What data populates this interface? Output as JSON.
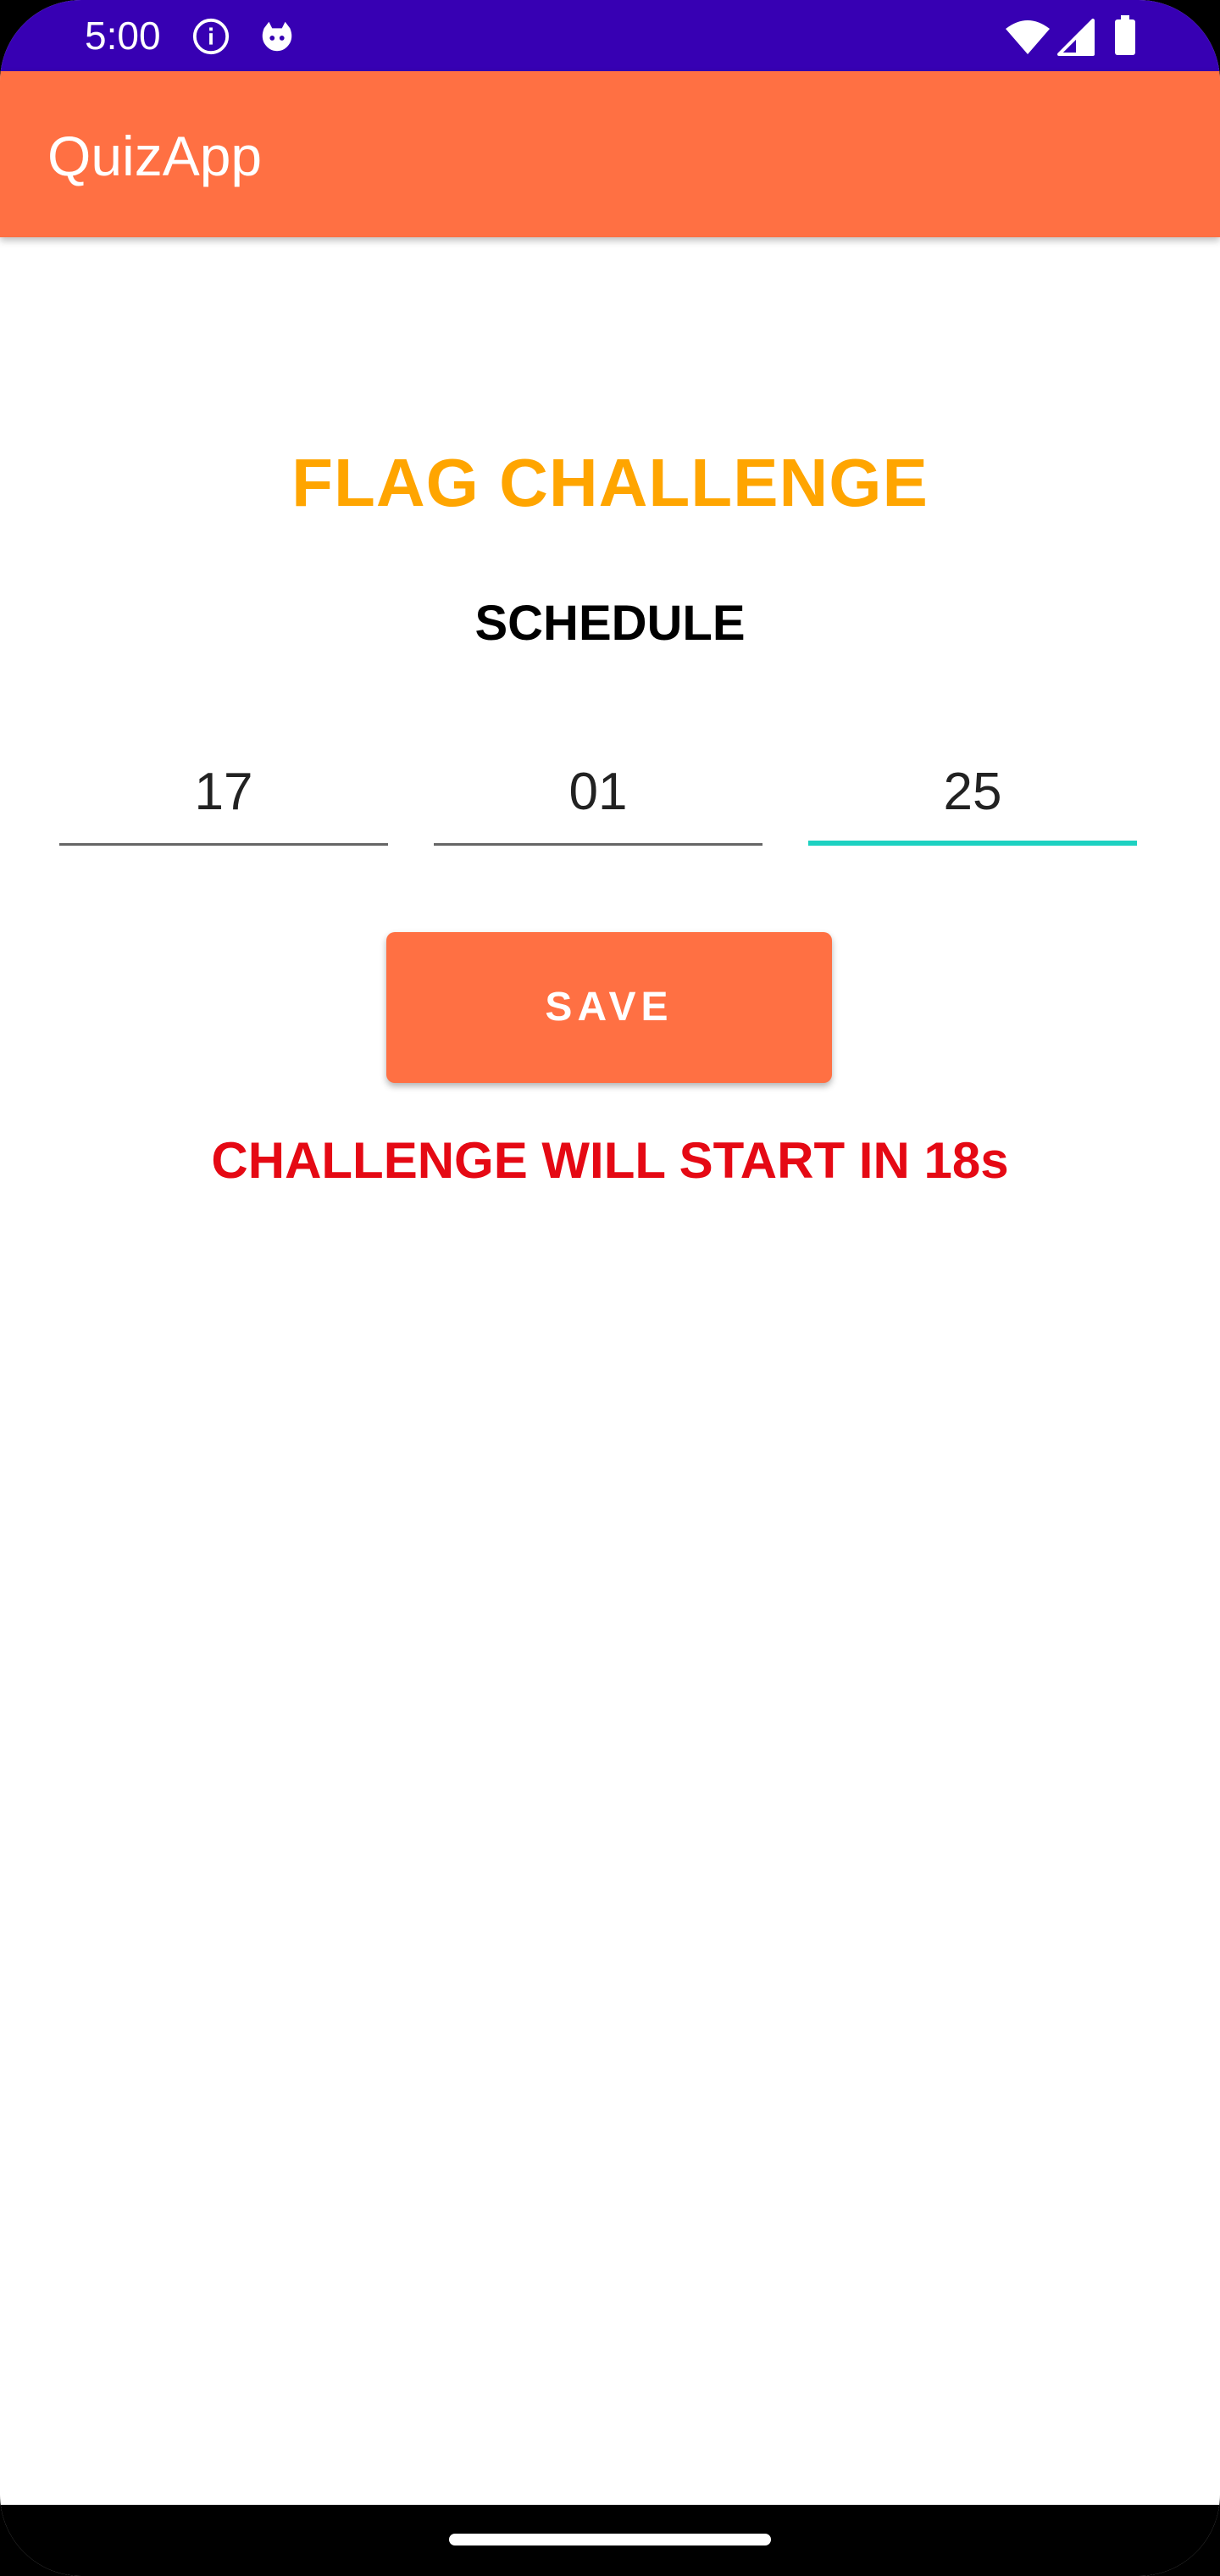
{
  "status_bar": {
    "time": "5:00",
    "left_icons": [
      "info-icon",
      "notification-cat-icon"
    ],
    "right_icons": [
      "wifi-icon",
      "cellular-signal-icon",
      "battery-icon"
    ],
    "background_color": "#3700B3"
  },
  "app_bar": {
    "title": "QuizApp",
    "background_color": "#FF7043"
  },
  "main": {
    "title": "FLAG CHALLENGE",
    "title_color": "#FFA500",
    "subtitle": "SCHEDULE",
    "time_fields": [
      {
        "value": "17"
      },
      {
        "value": "01"
      },
      {
        "value": "25",
        "focused": true
      }
    ],
    "save_label": "SAVE",
    "countdown": "CHALLENGE WILL START IN 18s",
    "countdown_color": "#E50914",
    "focus_color": "#1DD1C1"
  }
}
